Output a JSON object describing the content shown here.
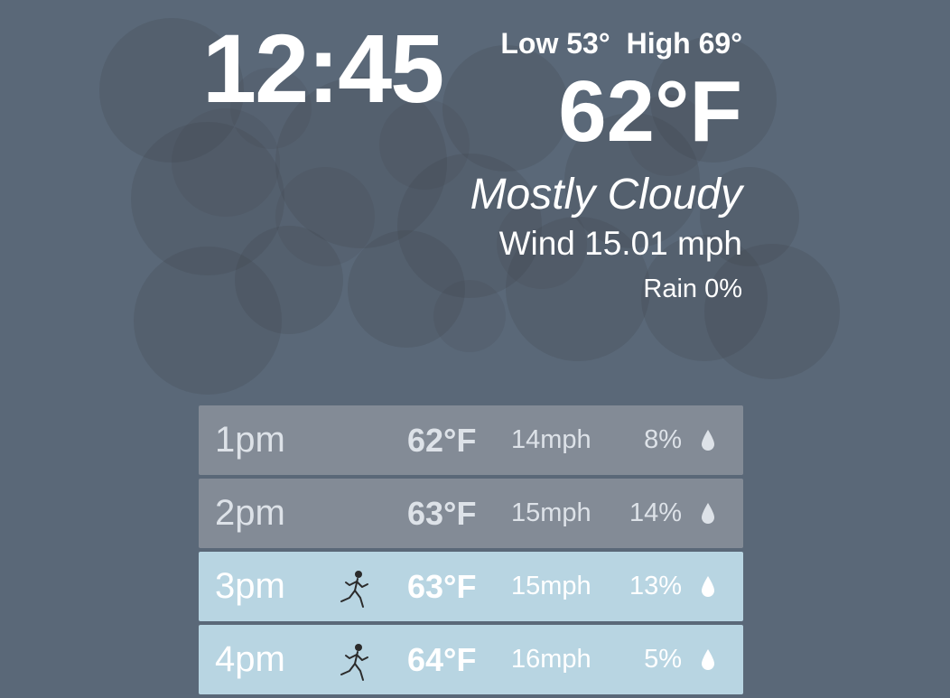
{
  "clock": {
    "time": "12:45"
  },
  "current": {
    "low_label": "Low 53°",
    "high_label": "High 69°",
    "temperature": "62°F",
    "condition": "Mostly Cloudy",
    "wind": "Wind 15.01 mph",
    "rain": "Rain 0%",
    "condition_icon": "cloud-cluster-icon"
  },
  "forecast": [
    {
      "time": "1pm",
      "temp": "62°F",
      "wind": "14mph",
      "rain": "8%",
      "good_for_running": false,
      "icon": "raindrop-icon"
    },
    {
      "time": "2pm",
      "temp": "63°F",
      "wind": "15mph",
      "rain": "14%",
      "good_for_running": false,
      "icon": "raindrop-icon"
    },
    {
      "time": "3pm",
      "temp": "63°F",
      "wind": "15mph",
      "rain": "13%",
      "good_for_running": true,
      "activity_icon": "running-person-icon",
      "icon": "raindrop-icon"
    },
    {
      "time": "4pm",
      "temp": "64°F",
      "wind": "16mph",
      "rain": "5%",
      "good_for_running": true,
      "activity_icon": "running-person-icon",
      "icon": "raindrop-icon"
    }
  ],
  "colors": {
    "background": "#5a6878",
    "row_default": "#838b96",
    "row_good": "#b8d5e2",
    "cloud": "#3e4348"
  }
}
